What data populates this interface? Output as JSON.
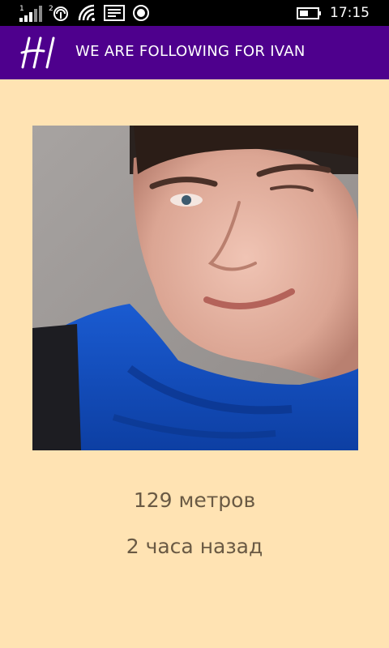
{
  "status_bar": {
    "signal_icon": "signal-strength-icon",
    "sim_label": "1",
    "sim_icon": "sim-icon",
    "wifi_icon": "wifi-icon",
    "message_icon": "message-icon",
    "location_icon": "location-icon",
    "battery_icon": "battery-icon",
    "time": "17:15"
  },
  "header": {
    "logo_text": "HI",
    "title": "WE ARE FOLLOWING FOR IVAN",
    "background_color": "#4e008d"
  },
  "profile": {
    "photo": "profile-photo"
  },
  "info": {
    "distance": "129 метров",
    "time_ago": "2 часа назад"
  },
  "colors": {
    "page_background": "#ffe3b3",
    "text": "#6a5a44"
  }
}
